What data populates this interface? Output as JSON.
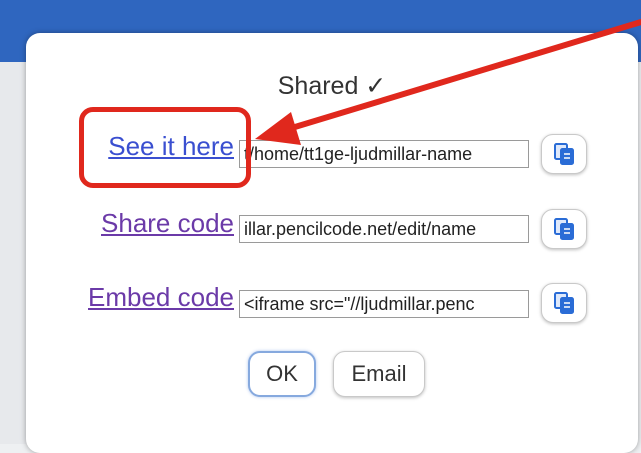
{
  "dialog": {
    "title": "Shared ✓",
    "rows": [
      {
        "link_label": "See it here",
        "url_value": "t/home/tt1ge-ljudmillar-name",
        "link_color": "#3a4fd0"
      },
      {
        "link_label": "Share code",
        "url_value": "illar.pencilcode.net/edit/name",
        "link_color": "#6b3aa8"
      },
      {
        "link_label": "Embed code",
        "url_value": "<iframe src=\"//ljudmillar.penc",
        "link_color": "#6b3aa8"
      }
    ],
    "copy_icon": "copy-icon",
    "ok_label": "OK",
    "email_label": "Email"
  },
  "annotation": {
    "highlight_color": "#e0281d",
    "arrow_color": "#e0281d"
  },
  "colors": {
    "top_bar": "#2f66bf",
    "dialog_bg": "#ffffff",
    "copy_icon": "#2a6cd6"
  }
}
